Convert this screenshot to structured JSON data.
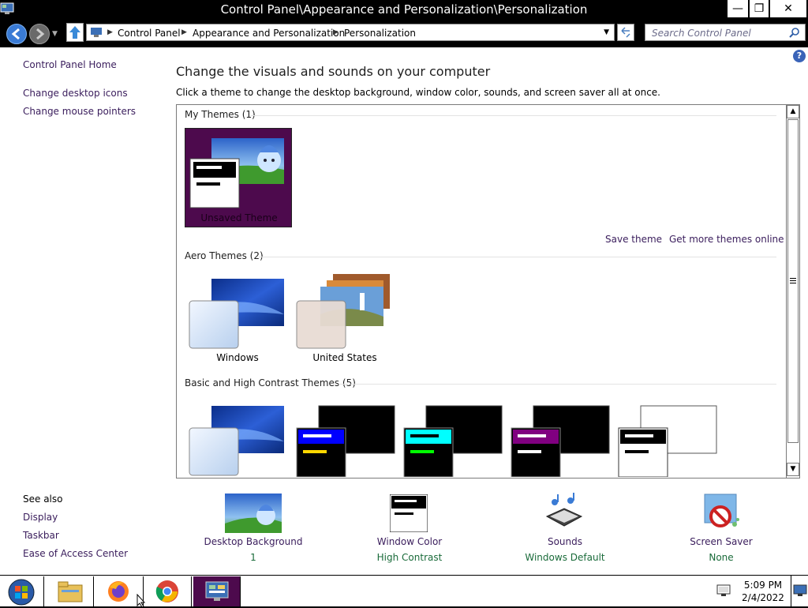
{
  "window": {
    "title": "Control Panel\\Appearance and Personalization\\Personalization",
    "minimize_glyph": "—",
    "maximize_glyph": "❐",
    "close_glyph": "✕"
  },
  "address": {
    "crumbs": [
      "Control Panel",
      "Appearance and Personalization",
      "Personalization"
    ],
    "search_placeholder": "Search Control Panel"
  },
  "sidebar": {
    "home": "Control Panel Home",
    "links": [
      "Change desktop icons",
      "Change mouse pointers"
    ],
    "see_also_title": "See also",
    "see_also": [
      "Display",
      "Taskbar",
      "Ease of Access Center"
    ]
  },
  "main": {
    "heading": "Change the visuals and sounds on your computer",
    "subheading": "Click a theme to change the desktop background, window color, sounds, and screen saver all at once.",
    "help_glyph": "?",
    "groups": [
      {
        "title": "My Themes (1)",
        "themes": [
          {
            "label": "Unsaved Theme"
          }
        ]
      },
      {
        "title": "Aero Themes (2)",
        "themes": [
          {
            "label": "Windows"
          },
          {
            "label": "United States"
          }
        ]
      },
      {
        "title": "Basic and High Contrast Themes (5)",
        "themes": []
      }
    ],
    "save_theme": "Save theme",
    "get_more": "Get more themes online"
  },
  "bottom": [
    {
      "label": "Desktop Background",
      "value": "1",
      "icon": "desktop-background-icon"
    },
    {
      "label": "Window Color",
      "value": "High Contrast",
      "icon": "window-color-icon"
    },
    {
      "label": "Sounds",
      "value": "Windows Default",
      "icon": "sounds-icon"
    },
    {
      "label": "Screen Saver",
      "value": "None",
      "icon": "screen-saver-icon"
    }
  ],
  "taskbar": {
    "time": "5:09 PM",
    "date": "2/4/2022",
    "apps": [
      "file-explorer-icon",
      "firefox-icon",
      "chrome-icon",
      "control-panel-icon"
    ]
  },
  "colors": {
    "link": "#3a1d5c",
    "value_green": "#1a6b3a",
    "selected_theme_bg": "#4d0a4d",
    "hc_blue": "#0000ff",
    "hc_cyan": "#00ffff",
    "hc_purple": "#800080"
  }
}
